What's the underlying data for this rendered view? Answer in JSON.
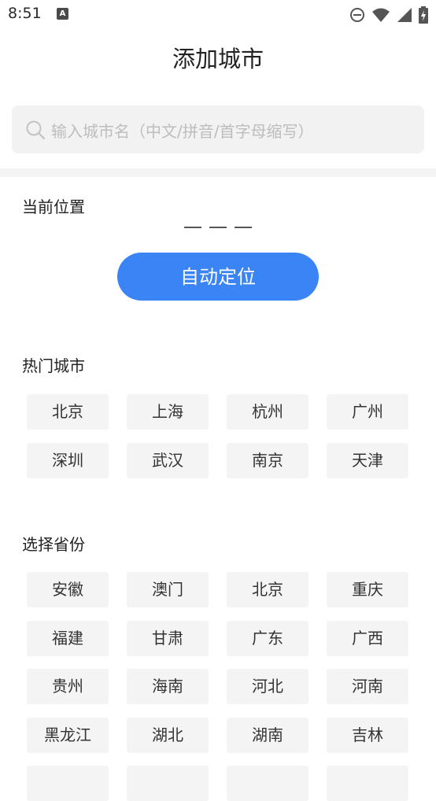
{
  "status_bar": {
    "time": "8:51",
    "notif_letter": "A",
    "icons": [
      "dnd-icon",
      "wifi-icon",
      "signal-icon",
      "battery-icon"
    ]
  },
  "page": {
    "title": "添加城市"
  },
  "search": {
    "placeholder": "输入城市名（中文/拼音/首字母缩写）"
  },
  "current_location": {
    "title": "当前位置",
    "button_label": "自动定位"
  },
  "hot_cities": {
    "title": "热门城市",
    "items": [
      "北京",
      "上海",
      "杭州",
      "广州",
      "深圳",
      "武汉",
      "南京",
      "天津"
    ]
  },
  "provinces": {
    "title": "选择省份",
    "items": [
      "安徽",
      "澳门",
      "北京",
      "重庆",
      "福建",
      "甘肃",
      "广东",
      "广西",
      "贵州",
      "海南",
      "河北",
      "河南",
      "黑龙江",
      "湖北",
      "湖南",
      "吉林",
      "",
      "",
      "",
      ""
    ]
  },
  "colors": {
    "accent": "#3a84f5",
    "chip_bg": "#f4f4f4",
    "search_bg": "#f2f2f2"
  }
}
